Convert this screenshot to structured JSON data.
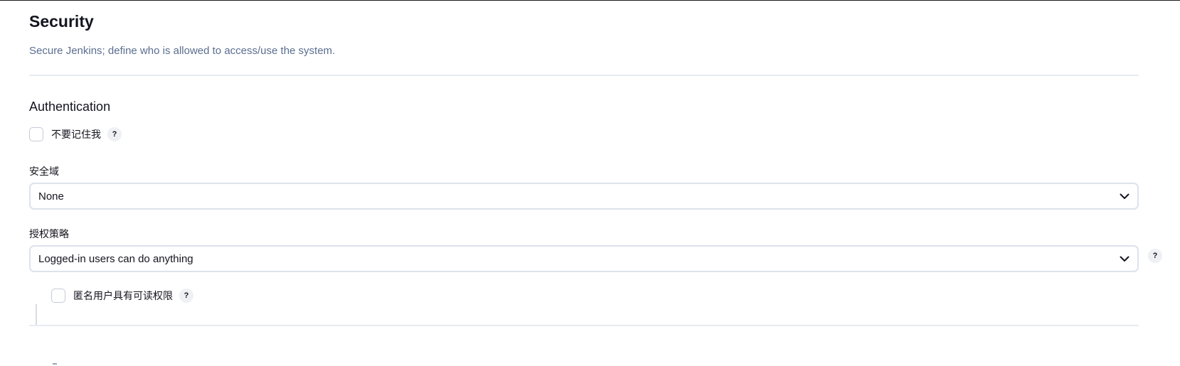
{
  "header": {
    "title": "Security",
    "subtitle": "Secure Jenkins; define who is allowed to access/use the system."
  },
  "authentication": {
    "section_title": "Authentication",
    "remember_me": {
      "label": "不要记住我",
      "checked": false,
      "help": "?"
    },
    "security_realm": {
      "label": "安全域",
      "value": "None"
    },
    "authorization": {
      "label": "授权策略",
      "value": "Logged-in users can do anything",
      "help": "?",
      "anonymous_read": {
        "label": "匿名用户具有可读权限",
        "checked": false,
        "help": "?"
      }
    }
  },
  "icons": {
    "chevron": "chevron-down-icon",
    "help": "help-icon"
  },
  "colors": {
    "subtitle": "#5b6e8f",
    "border": "#dde2ec",
    "divider": "#e8ebf1",
    "help_bg": "#eef0f4"
  }
}
